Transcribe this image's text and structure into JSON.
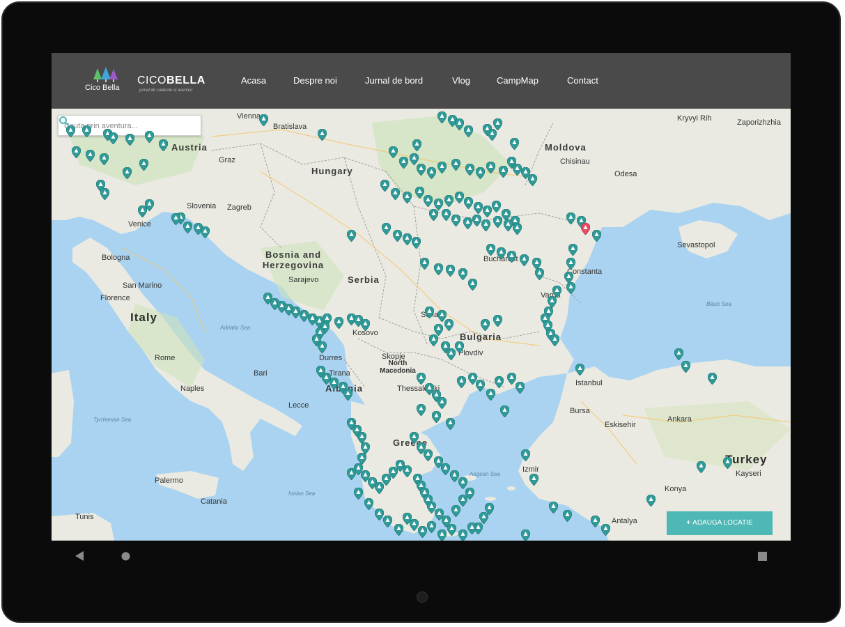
{
  "logo": {
    "small_text": "Cico Bella",
    "brand_regular": "CICO",
    "brand_bold": "BELLA",
    "tagline": "jurnal de calatorie si aventuri"
  },
  "nav": [
    "Acasa",
    "Despre noi",
    "Jurnal de bord",
    "Vlog",
    "CampMap",
    "Contact"
  ],
  "search": {
    "placeholder": "Cauta prin aventura..."
  },
  "add_button": {
    "icon": "plus-icon",
    "label": "ADAUGA LOCATIE"
  },
  "map_labels": {
    "countries": [
      "Austria",
      "Hungary",
      "Moldova",
      "Bosnia and Herzegovina",
      "Serbia",
      "Italy",
      "Bulgaria",
      "Albania",
      "North Macedonia",
      "Greece",
      "Turkey",
      "Slovenia"
    ],
    "cities": [
      "Vienna",
      "Bratislava",
      "Graz",
      "Zagreb",
      "Venice",
      "Bologna",
      "San Marino",
      "Florence",
      "Rome",
      "Naples",
      "Palermo",
      "Catania",
      "Tunis",
      "Sarajevo",
      "Sofia",
      "Plovdiv",
      "Tirana",
      "Thessaloniki",
      "Istanbul",
      "Bursa",
      "Ankara",
      "Kayseri",
      "Konya",
      "Antalya",
      "Izmir",
      "Eskisehir",
      "Odesa",
      "Chisinau",
      "Sevastopol",
      "Zaporizhzhia",
      "Kryvyi Rih",
      "Varna",
      "Bucharest",
      "Constanta",
      "Kosovo",
      "Lecce",
      "Bari",
      "Skopje",
      "Durres"
    ],
    "seas": [
      "Adriatic Sea",
      "Tyrrhenian Sea",
      "Ionian Sea",
      "Aegean Sea",
      "Black Sea"
    ]
  },
  "colors": {
    "pin": "#2f9a97",
    "pin_active": "#e84a5f",
    "button": "#4db8b5",
    "topbar": "#4a4a4a",
    "water": "#a9d3f0",
    "land": "#eaeae2"
  },
  "softkeys": {
    "back": "back-triangle-icon",
    "home": "home-circle-icon",
    "recents": "recents-square-icon"
  }
}
